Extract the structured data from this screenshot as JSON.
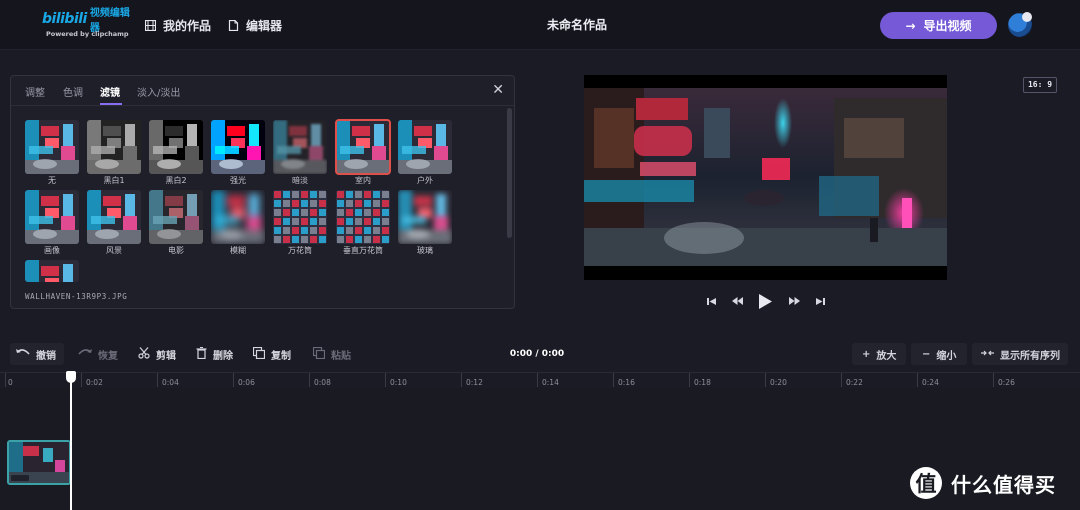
{
  "header": {
    "logo_bili": "bilibili",
    "logo_text": "视频编辑器",
    "logo_sub": "Powered by clipchamp",
    "nav_works": "我的作品",
    "nav_editor": "编辑器",
    "project_title": "未命名作品",
    "export_label": "导出视频"
  },
  "panel": {
    "tabs": [
      "调整",
      "色调",
      "滤镜",
      "淡入/淡出"
    ],
    "active_tab": "滤镜",
    "filters": [
      "无",
      "黑白1",
      "黑白2",
      "强光",
      "暗淡",
      "室内",
      "户外",
      "画像",
      "风景",
      "电影",
      "模糊",
      "万花筒",
      "垂直万花筒",
      "玻璃"
    ],
    "selected_filter": "室内",
    "file_name": "WALLHAVEN-13R9P3.JPG"
  },
  "preview": {
    "aspect_ratio": "16: 9"
  },
  "toolbar": {
    "undo": "撤销",
    "redo": "恢复",
    "cut": "剪辑",
    "delete": "删除",
    "copy": "复制",
    "paste": "粘贴",
    "time": "0:00 / 0:00",
    "zoom_in": "放大",
    "zoom_out": "缩小",
    "show_all": "显示所有序列"
  },
  "timeline": {
    "ticks": [
      "0",
      "0:02",
      "0:04",
      "0:06",
      "0:08",
      "0:10",
      "0:12",
      "0:14",
      "0:16",
      "0:18",
      "0:20",
      "0:22",
      "0:24",
      "0:26"
    ]
  },
  "watermark": {
    "glyph": "值",
    "text": "什么值得买"
  },
  "colors": {
    "accent": "#7559d6",
    "selection": "#e0504a",
    "clip_border": "#3ba3a8"
  }
}
